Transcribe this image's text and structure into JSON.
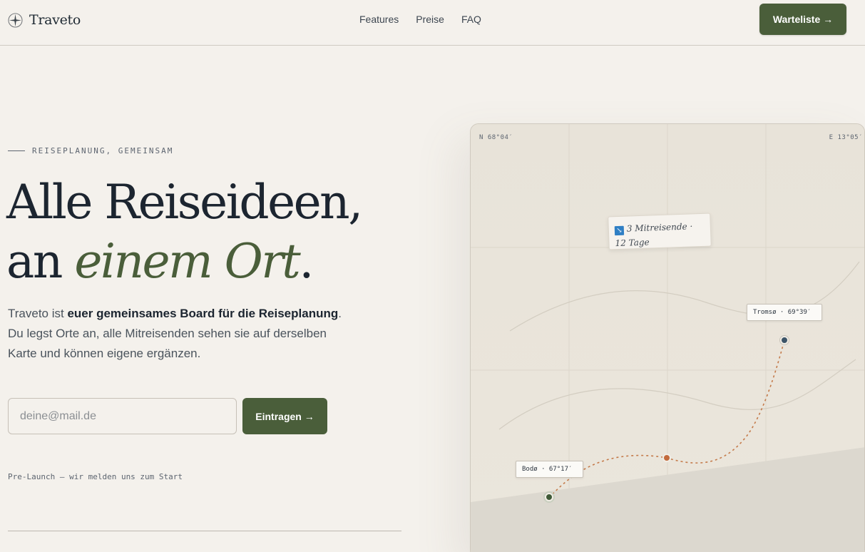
{
  "header": {
    "brand": "Traveto",
    "nav": [
      "Features",
      "Preise",
      "FAQ"
    ],
    "cta_label": "Warteliste →"
  },
  "hero": {
    "eyebrow": "REISEPLANUNG, GEMEINSAM",
    "headline_line1": "Alle Reiseideen,",
    "headline_line2_prefix": "an ",
    "headline_accent": "einem Ort",
    "headline_suffix": ".",
    "lead_part1": "Traveto ist ",
    "lead_bold": "euer gemeinsames Board für die Reiseplanung",
    "lead_part2": ". Du legst Orte an, alle Mitreisenden sehen sie auf derselben Karte und können eigene ergänzen.",
    "email_placeholder": "deine@mail.de",
    "submit_label": "Eintragen →",
    "prelaunch_note": "Pre-Launch — wir melden uns zum Start"
  },
  "map": {
    "coord_north": "N 68°04′",
    "coord_east": "E 13°05′",
    "note_text": "3 Mitreisende · 12 Tage",
    "places": [
      {
        "name": "Tromsø · 69°39′"
      },
      {
        "name": "Bodø · 67°17′"
      }
    ],
    "colors": {
      "pin_tromso": "#3c5468",
      "pin_mid": "#c26a3c",
      "pin_bodo": "#3f5a37",
      "route": "#c47a4a"
    }
  },
  "colors": {
    "background": "#f4f1ec",
    "accent_green": "#4a5e3a",
    "text_dark": "#1c2530"
  }
}
